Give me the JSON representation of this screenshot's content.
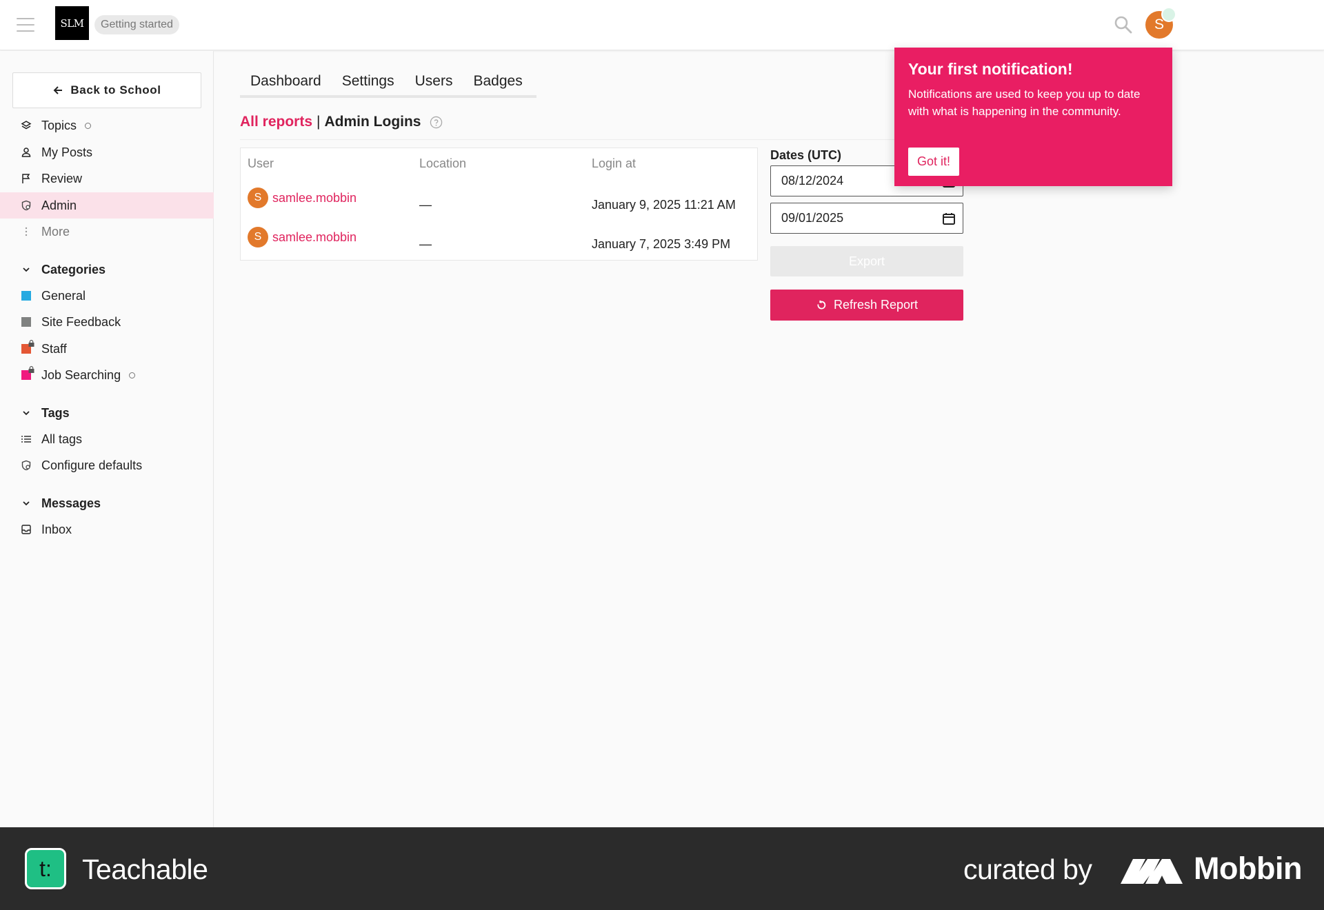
{
  "header": {
    "logo_text": "SLM",
    "getting_started": "Getting started",
    "avatar_letter": "S"
  },
  "sidebar": {
    "back_label": "Back to School",
    "nav": [
      {
        "label": "Topics",
        "icon": "layers-icon"
      },
      {
        "label": "My Posts",
        "icon": "user-icon"
      },
      {
        "label": "Review",
        "icon": "flag-icon"
      },
      {
        "label": "Admin",
        "icon": "shield-icon"
      },
      {
        "label": "More",
        "icon": "ellipsis-icon"
      }
    ],
    "categories": {
      "title": "Categories",
      "items": [
        {
          "label": "General",
          "color": "#25aae1"
        },
        {
          "label": "Site Feedback",
          "color": "#808281"
        },
        {
          "label": "Staff",
          "color": "#e45735"
        },
        {
          "label": "Job Searching",
          "color": "#f0197f"
        }
      ]
    },
    "tags": {
      "title": "Tags",
      "items": [
        {
          "label": "All tags",
          "icon": "list-icon"
        },
        {
          "label": "Configure defaults",
          "icon": "shield-icon"
        }
      ]
    },
    "messages": {
      "title": "Messages",
      "items": [
        {
          "label": "Inbox",
          "icon": "inbox-icon"
        }
      ]
    }
  },
  "tabs": [
    "Dashboard",
    "Settings",
    "Users",
    "Badges"
  ],
  "report": {
    "all_reports_label": "All reports",
    "separator": "|",
    "title": "Admin Logins",
    "columns": [
      "User",
      "Location",
      "Login at"
    ],
    "rows": [
      {
        "avatar": "S",
        "user": "samlee.mobbin",
        "location": "—",
        "login_at": "January 9, 2025 11:21 AM"
      },
      {
        "avatar": "S",
        "user": "samlee.mobbin",
        "location": "—",
        "login_at": "January 7, 2025 3:49 PM"
      }
    ]
  },
  "filters": {
    "dates_label": "Dates (UTC)",
    "start_date": "08/12/2024",
    "end_date": "09/01/2025",
    "export_label": "Export",
    "refresh_label": "Refresh Report"
  },
  "notification": {
    "title": "Your first notification!",
    "body": "Notifications are used to keep you up to date with what is happening in the community.",
    "button": "Got it!"
  },
  "footer": {
    "brand_glyph": "t:",
    "brand": "Teachable",
    "curated_by": "curated by",
    "curator": "Mobbin"
  },
  "colors": {
    "accent": "#e0245e",
    "popup": "#e91e63",
    "avatar": "#e2792b",
    "active_bg": "#fbe1e9",
    "footer_bg": "#2b2b2b"
  }
}
